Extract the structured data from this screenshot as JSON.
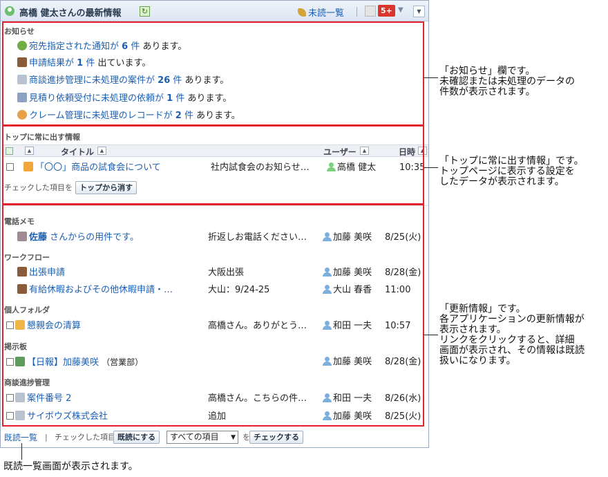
{
  "header": {
    "title": "高橋 健太さんの最新情報",
    "unread_label": "未読一覧",
    "badge": "5+"
  },
  "notices": {
    "section_label": "お知らせ",
    "items": [
      {
        "pre": "宛先指定された通知が",
        "num": "6",
        "unit": "件",
        "post": "あります。"
      },
      {
        "pre": "申請結果が",
        "num": "1",
        "unit": "件",
        "post": "出ています。"
      },
      {
        "pre": "商談進捗管理に未処理の案件が",
        "num": "26",
        "unit": "件",
        "post": "あります。"
      },
      {
        "pre": "見積り依頼受付に未処理の依頼が",
        "num": "1",
        "unit": "件",
        "post": "あります。"
      },
      {
        "pre": "クレーム管理に未処理のレコードが",
        "num": "2",
        "unit": "件",
        "post": "あります。"
      }
    ]
  },
  "pinned": {
    "section_label": "トップに常に出す情報",
    "col_title": "タイトル",
    "col_user": "ユーザー",
    "col_date": "日時",
    "row": {
      "title": "「〇〇」商品の試食会について",
      "summary": "社内試食会のお知らせ…",
      "user": "高橋 健太",
      "time": "10:35"
    },
    "checked_label": "チェックした項目を",
    "remove_button": "トップから消す"
  },
  "updates": {
    "groups": [
      {
        "label": "電話メモ",
        "rows": [
          {
            "title_bold": "佐藤",
            "title": " さんからの用件です。",
            "summary": "折返しお電話ください…",
            "user": "加藤 美咲",
            "time": "8/25(火)"
          }
        ]
      },
      {
        "label": "ワークフロー",
        "rows": [
          {
            "title": "出張申請",
            "summary": "大阪出張",
            "user": "加藤 美咲",
            "time": "8/28(金)"
          },
          {
            "title": "有給休暇およびその他休暇申請・…",
            "summary": "大山：9/24-25",
            "user": "大山 春香",
            "time": "11:00"
          }
        ]
      },
      {
        "label": "個人フォルダ",
        "rows": [
          {
            "title": "懇親会の清算",
            "summary": "高橋さん。ありがとう…",
            "user": "和田 一夫",
            "time": "10:57"
          }
        ]
      },
      {
        "label": "掲示板",
        "rows": [
          {
            "title": "【日報】加藤美咲",
            "extra": "（営業部）",
            "summary": "",
            "user": "加藤 美咲",
            "time": "8/28(金)"
          }
        ]
      },
      {
        "label": "商談進捗管理",
        "rows": [
          {
            "title": "案件番号 2",
            "summary": "高橋さん。こちらの件…",
            "user": "和田 一夫",
            "time": "8/26(水)"
          },
          {
            "title": "サイボウズ株式会社",
            "summary": "追加",
            "user": "加藤 美咲",
            "time": "8/25(火)"
          }
        ]
      }
    ]
  },
  "footer": {
    "read_list": "既読一覧",
    "divider": "|",
    "checked_label": "チェックした項目を",
    "mark_read_button": "既読にする",
    "select_value": "すべての項目",
    "wo": "を",
    "check_button": "チェックする"
  },
  "annotations": {
    "notice": "「お知らせ」欄です。\n未確認または未処理のデータの\n件数が表示されます。",
    "pinned": "「トップに常に出す情報」です。\nトップページに表示する設定を\nしたデータが表示されます。",
    "updates": "「更新情報」です。\n各アプリケーションの更新情報が\n表示されます。\nリンクをクリックすると、詳細\n画面が表示され、その情報は既読\n扱いになります。",
    "read_list": "既読一覧画面が表示されます。"
  }
}
